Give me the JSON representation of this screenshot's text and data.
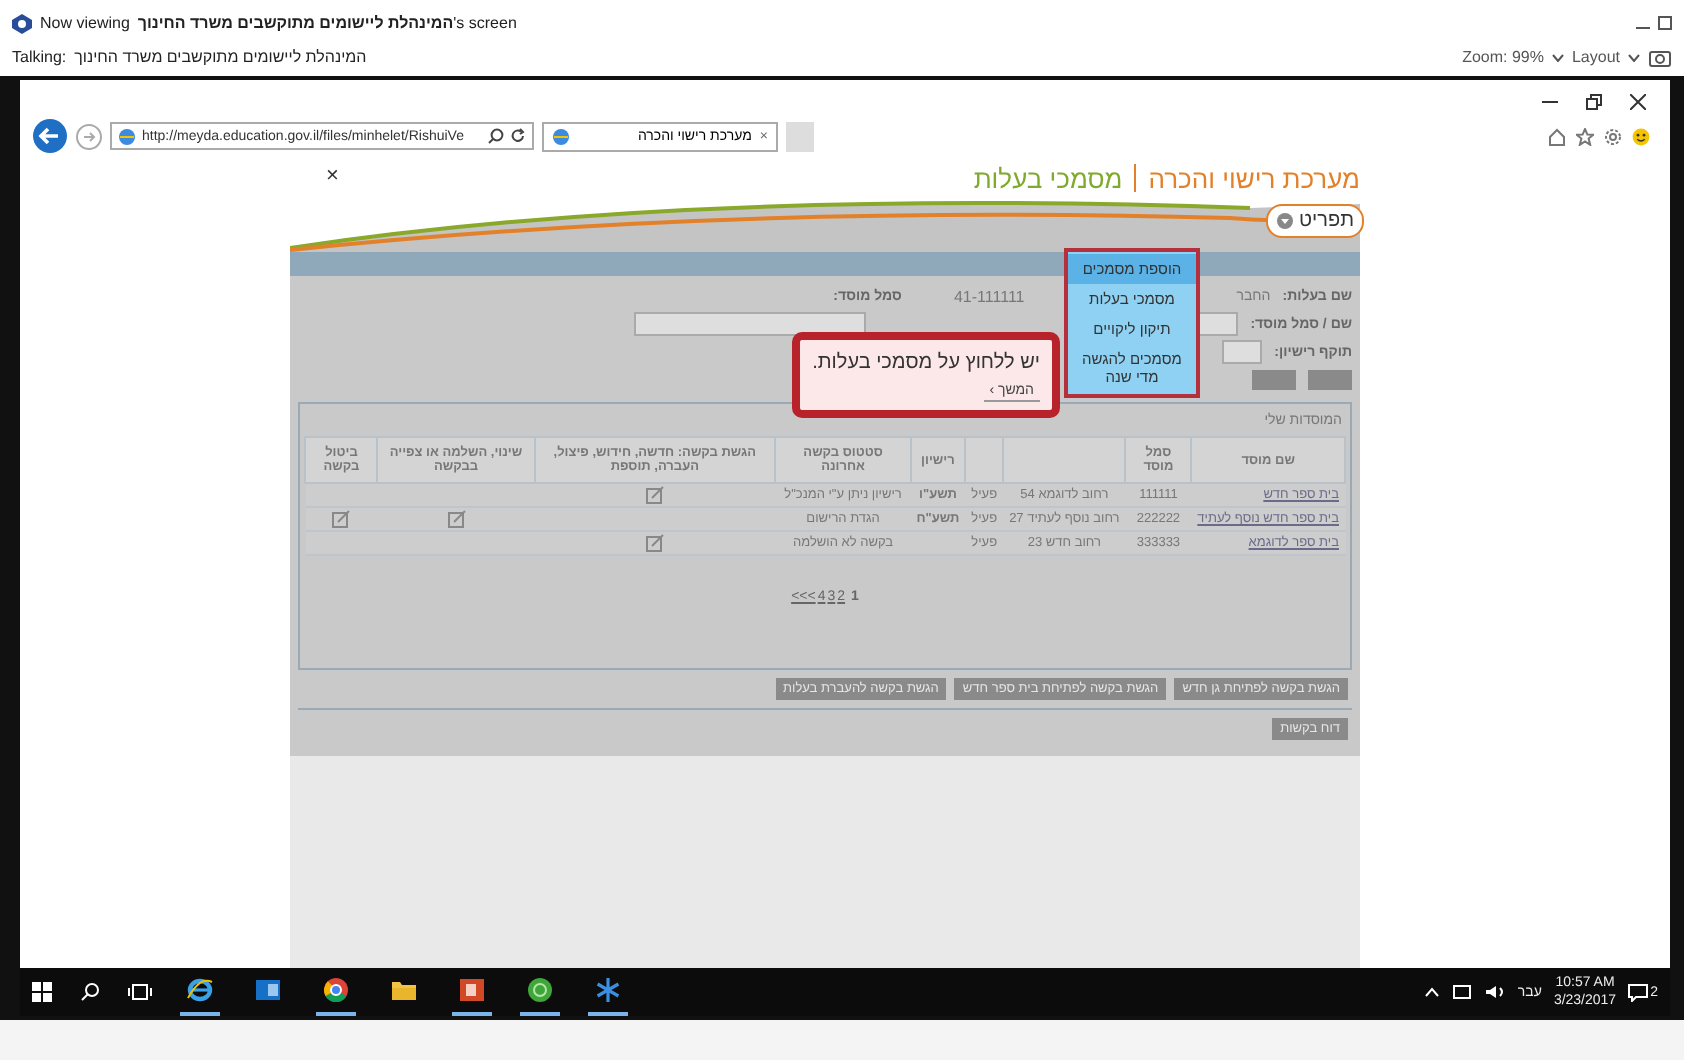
{
  "viewer_bar": {
    "viewing_prefix": "Now viewing",
    "viewing_name": "המינהלת ליישומים מתוקשבים משרד החינוך",
    "viewing_suffix": "'s screen",
    "talking_label": "Talking:",
    "talking_name": "המינהלת ליישומים מתוקשבים משרד החינוך",
    "zoom": "Zoom: 99%",
    "layout": "Layout"
  },
  "browser": {
    "url": "http://meyda.education.gov.il/files/minhelet/RishuiVe",
    "tab": "מערכת רישוי והכרה",
    "tab_close": "×"
  },
  "page": {
    "close": "×",
    "system_title": "מערכת רישוי והכרה",
    "section_title": "מסמכי בעלות",
    "menu_label": "תפריט",
    "menu_items": [
      {
        "label": "הוספת מסמכים",
        "selected": true
      },
      {
        "label": "מסמכי בעלות",
        "selected": false
      },
      {
        "label": "תיקון ליקויים",
        "selected": false
      },
      {
        "label": "מסמכים להגשה מדי שנה",
        "selected": false
      }
    ],
    "form": {
      "owner_label": "שם בעלות:",
      "owner_value": "החבר",
      "code_value": "41-111111",
      "code_label": "סמל מוסד:",
      "institution_label": "שם / סמל מוסד:",
      "license_label": "תוקף רישיון:"
    },
    "tooltip": {
      "text": "יש ללחוץ על מסמכי בעלות.",
      "next": "המשך ›"
    },
    "table": {
      "caption": "המוסדות שלי",
      "columns": [
        {
          "label": "שם מוסד"
        },
        {
          "label": "סמל מוסד"
        },
        {},
        {},
        {
          "label": "רישיון"
        },
        {
          "label": "סטטוס בקשה אחרונה"
        },
        {
          "label": "הגשת בקשה: חדשה, חידוש, פיצול, העברה, תוספת"
        },
        {
          "label": "שינוי, השלמה או צפייה בבקשה"
        },
        {
          "label": "ביטול בקשה"
        }
      ],
      "rows": [
        {
          "name": "בית ספר חדש",
          "code": "111111",
          "address": "רחוב לדוגמא 54",
          "status": "פעיל",
          "year": "תשע\"ו",
          "request_status": "רישיון ניתן ע\"י המנכ\"ל",
          "can_submit": true,
          "can_edit": false,
          "can_cancel": false
        },
        {
          "name": "בית ספר חדש נוסף לעתיד",
          "code": "222222",
          "address": "רחוב נוסף לעתיד 27",
          "status": "פעיל",
          "year": "תשע\"ח",
          "request_status": "הגדת הרישום",
          "can_submit": false,
          "can_edit": true,
          "can_cancel": true
        },
        {
          "name": "בית ספר לדוגמא",
          "code": "333333",
          "address": "רחוב חדש 23",
          "status": "פעיל",
          "year": "",
          "request_status": "בקשה לא הושלמה",
          "can_submit": true,
          "can_edit": false,
          "can_cancel": false
        }
      ]
    },
    "pagination": [
      {
        "label": "1",
        "selected": true
      },
      {
        "label": "2",
        "selected": false
      },
      {
        "label": "3",
        "selected": false
      },
      {
        "label": "4",
        "selected": false
      },
      {
        "label": "<<<",
        "selected": false
      }
    ],
    "request_buttons": [
      "הגשת בקשה לפתיחת גן חדש",
      "הגשת בקשה לפתיחת בית ספר חדש",
      "הגשת בקשה להעברת בעלות"
    ],
    "report_button": "דוח בקשות"
  },
  "taskbar": {
    "apps": [
      {
        "kind": "ie",
        "running": true
      },
      {
        "kind": "outlook",
        "running": false
      },
      {
        "kind": "chrome",
        "running": true
      },
      {
        "kind": "folder",
        "running": false
      },
      {
        "kind": "powerpoint",
        "running": true
      },
      {
        "kind": "green",
        "running": true
      },
      {
        "kind": "snowflake",
        "running": true
      }
    ],
    "language": "עבר",
    "time": "10:57 AM",
    "date": "3/23/2017",
    "notifications": "2"
  }
}
